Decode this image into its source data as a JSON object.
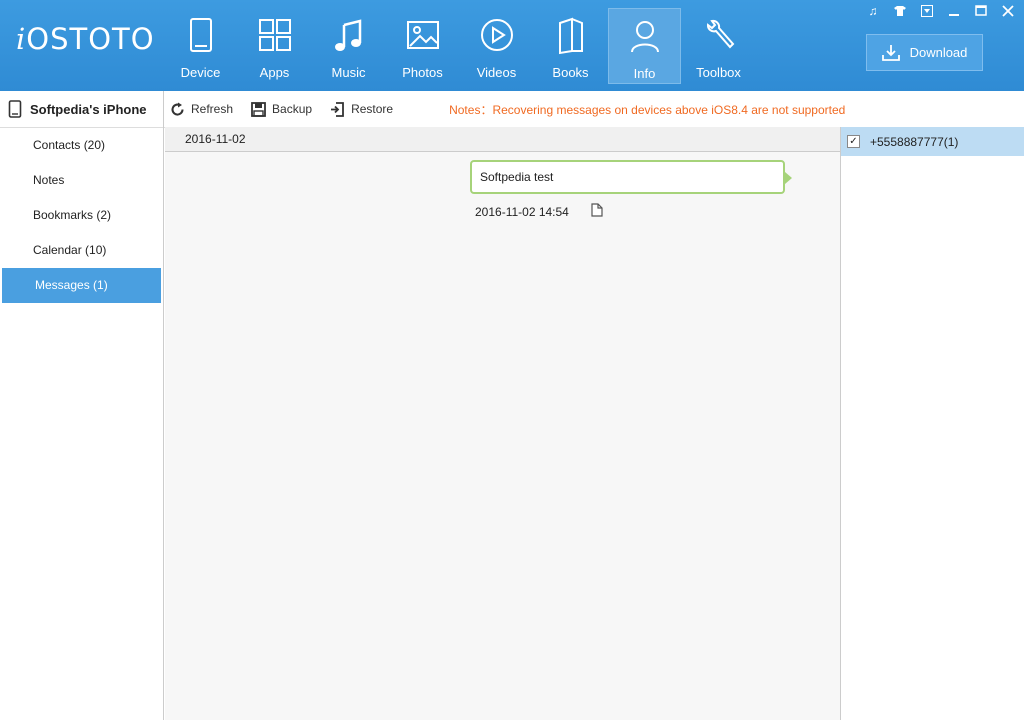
{
  "app": {
    "logo_i": "i",
    "logo_rest": "OSTOTO"
  },
  "nav": {
    "items": [
      {
        "label": "Device",
        "icon": "device-icon"
      },
      {
        "label": "Apps",
        "icon": "apps-icon"
      },
      {
        "label": "Music",
        "icon": "music-icon"
      },
      {
        "label": "Photos",
        "icon": "photos-icon"
      },
      {
        "label": "Videos",
        "icon": "videos-icon"
      },
      {
        "label": "Books",
        "icon": "books-icon"
      },
      {
        "label": "Info",
        "icon": "info-icon",
        "active": true
      },
      {
        "label": "Toolbox",
        "icon": "toolbox-icon"
      }
    ]
  },
  "download": {
    "label": "Download"
  },
  "sidebar": {
    "device_name": "Softpedia's iPhone",
    "items": [
      {
        "label": "Contacts (20)"
      },
      {
        "label": "Notes"
      },
      {
        "label": "Bookmarks (2)"
      },
      {
        "label": "Calendar (10)"
      },
      {
        "label": "Messages (1)",
        "active": true
      }
    ]
  },
  "toolbar": {
    "refresh": "Refresh",
    "backup": "Backup",
    "restore": "Restore",
    "notes": "Notes：Recovering messages on devices above iOS8.4 are not supported"
  },
  "messages": {
    "date_header": "2016-11-02",
    "items": [
      {
        "text": "Softpedia test",
        "time": "2016-11-02 14:54"
      }
    ]
  },
  "contacts": {
    "items": [
      {
        "label": "+5558887777(1)",
        "checked": true
      }
    ]
  },
  "colors": {
    "accent": "#3d9be0",
    "active_item": "#4a9fe0",
    "notes": "#f06a22",
    "bubble_border": "#a6d37a",
    "selected_row": "#bddcf3"
  }
}
